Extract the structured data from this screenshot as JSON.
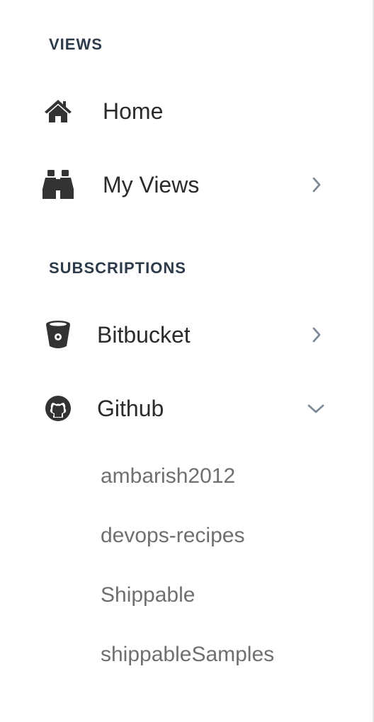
{
  "sidebar": {
    "views_heading": "VIEWS",
    "subscriptions_heading": "SUBSCRIPTIONS",
    "views": [
      {
        "label": "Home",
        "icon": "home-icon"
      },
      {
        "label": "My Views",
        "icon": "binoculars-icon",
        "expand": "chevron-right-icon"
      }
    ],
    "subscriptions": [
      {
        "label": "Bitbucket",
        "icon": "bitbucket-icon",
        "expand": "chevron-right-icon"
      },
      {
        "label": "Github",
        "icon": "github-icon",
        "expand": "chevron-down-icon"
      }
    ],
    "github_orgs": [
      "ambarish2012",
      "devops-recipes",
      "Shippable",
      "shippableSamples"
    ]
  },
  "colors": {
    "heading": "#2c3a4a",
    "label": "#2b2b2b",
    "sub_label": "#6f6f6f",
    "chevron": "#7d8a96",
    "icon": "#333333",
    "border": "#e6e6e6"
  }
}
